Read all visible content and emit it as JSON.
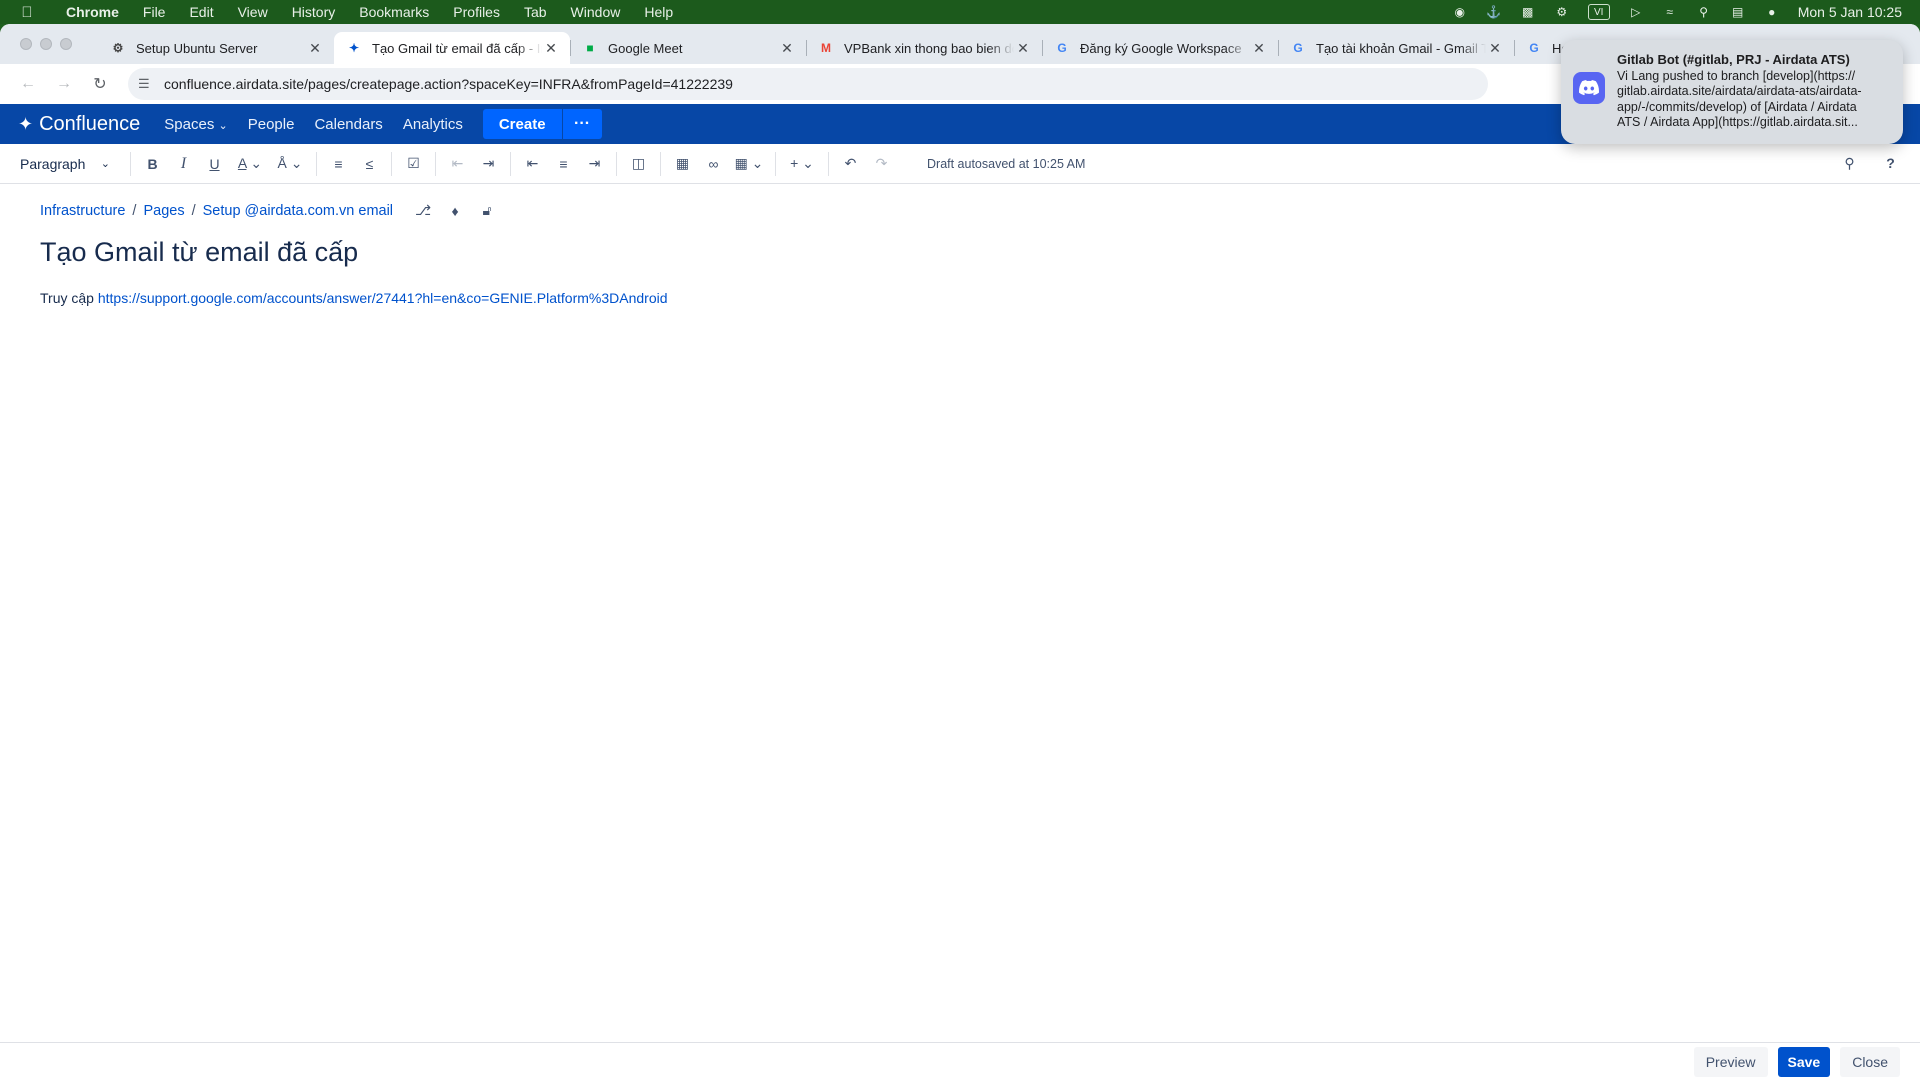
{
  "menubar": {
    "app": "Chrome",
    "items": [
      "File",
      "Edit",
      "View",
      "History",
      "Bookmarks",
      "Profiles",
      "Tab",
      "Window",
      "Help"
    ],
    "vi_label": "VI",
    "clock": "Mon 5 Jan  10:25"
  },
  "tabs": [
    {
      "title": "Setup Ubuntu Server",
      "icon": "gear-icon"
    },
    {
      "title": "Tạo Gmail từ email đã cấp - In",
      "icon": "confluence-icon"
    },
    {
      "title": "Google Meet",
      "icon": "google-meet-icon"
    },
    {
      "title": "VPBank xin thong bao bien do",
      "icon": "gmail-icon"
    },
    {
      "title": "Đăng ký Google Workspace",
      "icon": "google-icon"
    },
    {
      "title": "Tạo tài khoản Gmail - Gmail Tr",
      "icon": "google-icon"
    },
    {
      "title": "He",
      "icon": "google-icon"
    }
  ],
  "address": {
    "url": "confluence.airdata.site/pages/createpage.action?spaceKey=INFRA&fromPageId=41222239"
  },
  "confluence": {
    "logo": "Confluence",
    "nav": [
      "Spaces",
      "People",
      "Calendars",
      "Analytics"
    ],
    "create_label": "Create",
    "more_label": "···"
  },
  "editor_toolbar": {
    "paragraph_style": "Paragraph",
    "autosave": "Draft autosaved at 10:25 AM"
  },
  "breadcrumb": [
    "Infrastructure",
    "Pages",
    "Setup @airdata.com.vn email"
  ],
  "page": {
    "title": "Tạo Gmail từ email đã cấp",
    "body_prefix": "Truy cập",
    "link": "https://support.google.com/accounts/answer/27441?hl=en&co=GENIE.Platform%3DAndroid"
  },
  "footer": {
    "preview_label": "Preview",
    "save_label": "Save",
    "close_label": "Close"
  },
  "notification": {
    "title": "Gitlab Bot (#gitlab, PRJ - Airdata ATS)",
    "body": "Vi Lang pushed to branch [develop](https://\ngitlab.airdata.site/airdata/airdata-ats/airdata-\napp/-/commits/develop) of [Airdata / Airdata\nATS / Airdata App](https://gitlab.airdata.sit..."
  }
}
